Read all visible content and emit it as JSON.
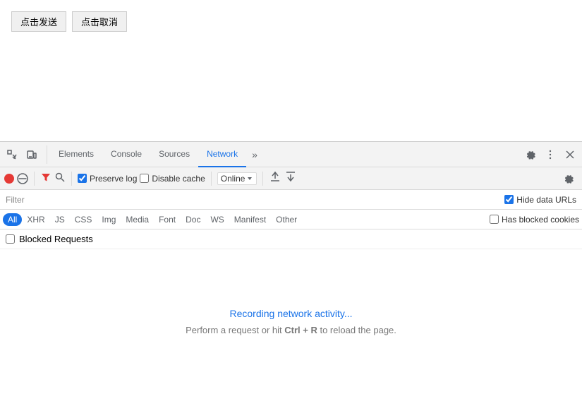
{
  "page": {
    "btn_submit": "点击发送",
    "btn_cancel": "点击取消"
  },
  "devtools": {
    "tabs": [
      {
        "id": "elements",
        "label": "Elements",
        "active": false
      },
      {
        "id": "console",
        "label": "Console",
        "active": false
      },
      {
        "id": "sources",
        "label": "Sources",
        "active": false
      },
      {
        "id": "network",
        "label": "Network",
        "active": true
      }
    ],
    "more_tabs_label": "»",
    "controls": {
      "preserve_log": "Preserve log",
      "disable_cache": "Disable cache",
      "online": "Online"
    },
    "filter": {
      "placeholder": "Filter",
      "hide_data_urls": "Hide data URLs"
    },
    "type_filters": [
      "All",
      "XHR",
      "JS",
      "CSS",
      "Img",
      "Media",
      "Font",
      "Doc",
      "WS",
      "Manifest",
      "Other"
    ],
    "has_blocked_cookies": "Has blocked cookies",
    "blocked_requests": "Blocked Requests",
    "recording_text": "Recording network activity...",
    "hint_text": "Perform a request or hit "
  }
}
